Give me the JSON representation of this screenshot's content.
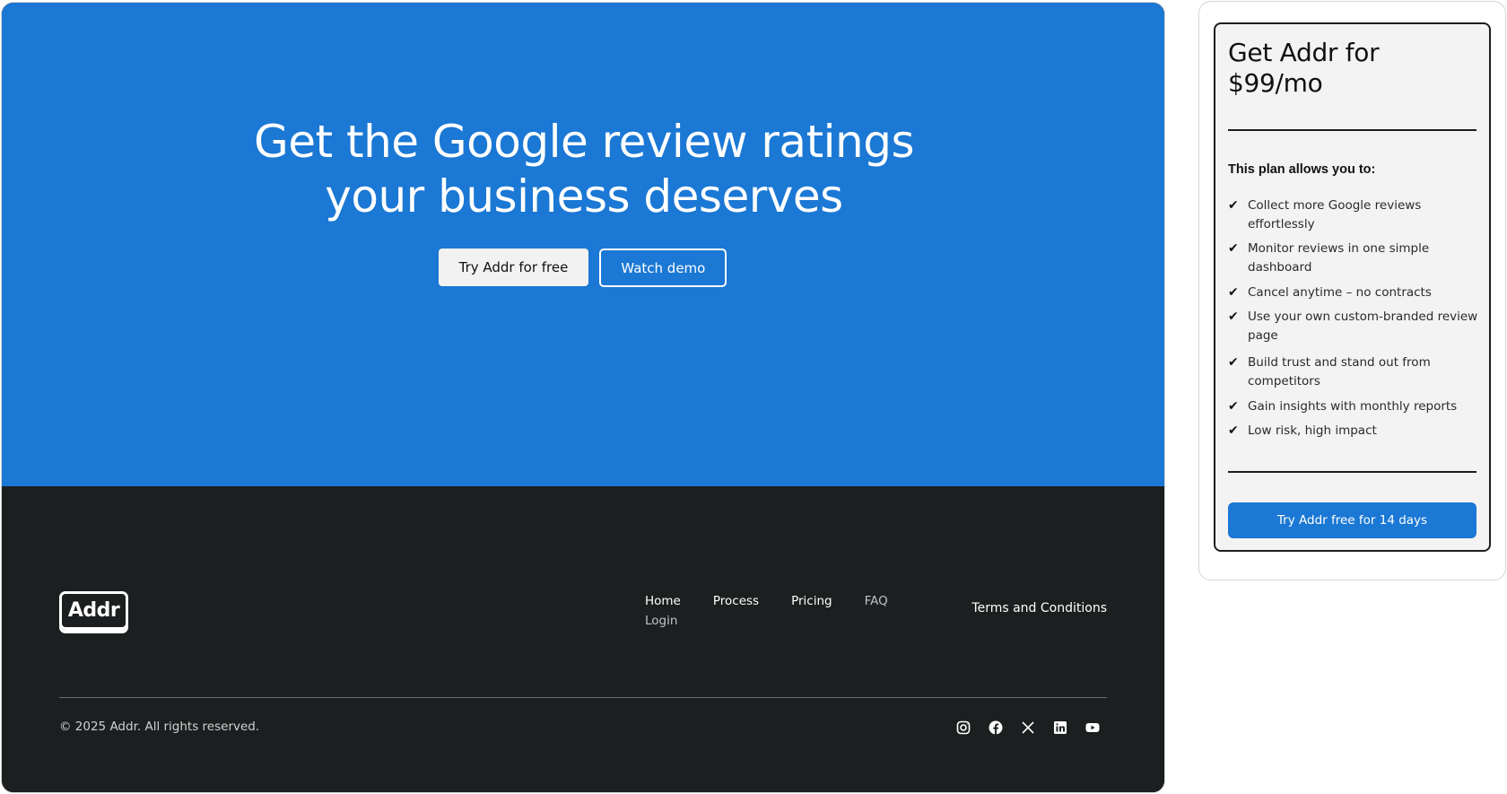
{
  "hero": {
    "title_line1": "Get the Google review ratings",
    "title_line2": "your business deserves",
    "primary_button": "Try Addr for free",
    "secondary_button": "Watch demo",
    "background_color": "#1b78d4"
  },
  "footer": {
    "logo_text": "Addr",
    "nav": {
      "home": "Home",
      "process": "Process",
      "pricing": "Pricing",
      "faq": "FAQ",
      "login": "Login"
    },
    "terms": "Terms and Conditions",
    "copyright": "© 2025 Addr. All rights reserved.",
    "socials": [
      "instagram-icon",
      "facebook-icon",
      "x-icon",
      "linkedin-icon",
      "youtube-icon"
    ],
    "background_color": "#1c1f1f"
  },
  "pricing_card": {
    "title_line1": "Get Addr for",
    "title_line2": "$99/mo",
    "subtitle": "This plan allows you to:",
    "features": [
      "Collect more Google reviews effortlessly",
      "Monitor reviews in one simple dashboard",
      "Cancel anytime – no contracts",
      "Use your own custom-branded review page",
      "Build trust and stand out from competitors",
      "Gain insights with monthly reports",
      "Low risk, high impact"
    ],
    "button": "Try Addr free for 14 days",
    "accent_color": "#1b78d4"
  }
}
